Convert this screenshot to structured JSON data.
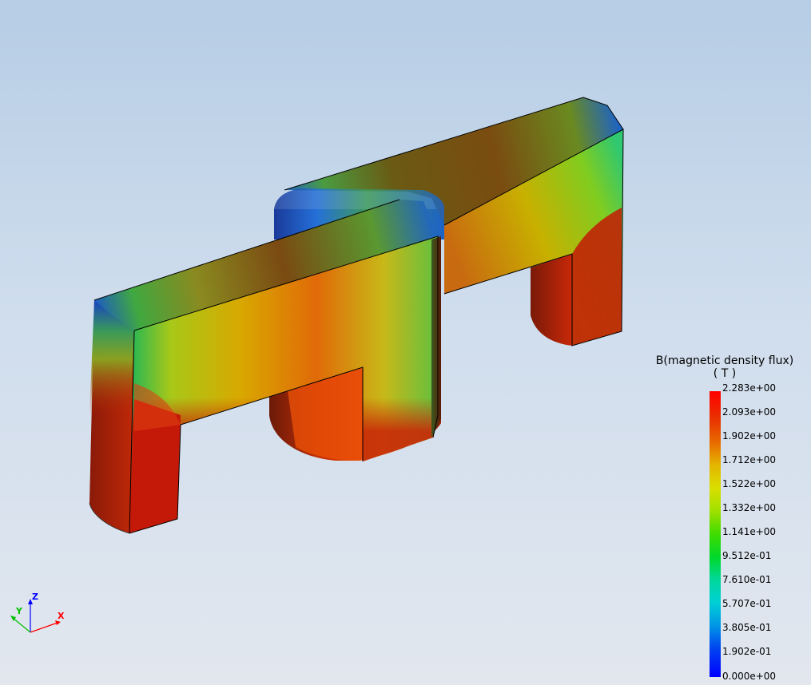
{
  "legend": {
    "title_line1": "B(magnetic density flux)",
    "title_line2": "( T )",
    "ticks": [
      "2.283e+00",
      "2.093e+00",
      "1.902e+00",
      "1.712e+00",
      "1.522e+00",
      "1.332e+00",
      "1.141e+00",
      "9.512e-01",
      "7.610e-01",
      "5.707e-01",
      "3.805e-01",
      "1.902e-01",
      "0.000e+00"
    ],
    "max_color": "#ff0000",
    "min_color": "#0000ff"
  },
  "axes": {
    "x": "X",
    "y": "Y",
    "z": "Z",
    "x_color": "#ff0000",
    "y_color": "#00c000",
    "z_color": "#0000ff"
  }
}
